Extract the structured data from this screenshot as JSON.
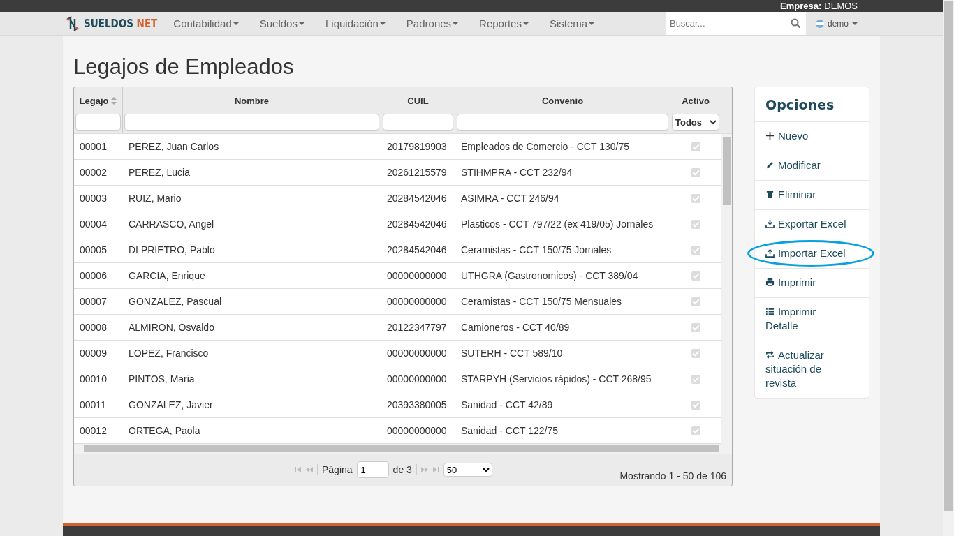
{
  "top_bar": {
    "company_label": "Empresa:",
    "company": "DEMOS"
  },
  "navbar": {
    "brand_a": "SUELDOS",
    "brand_b": "NET",
    "menus": [
      "Contabilidad",
      "Sueldos",
      "Liquidación",
      "Padrones",
      "Reportes",
      "Sistema"
    ],
    "search": {
      "placeholder": "Buscar..."
    },
    "user": "demo"
  },
  "page_title": "Legajos de Empleados",
  "table": {
    "columns": [
      {
        "label": "Legajo",
        "sortable": true,
        "filter": {
          "kind": "text"
        }
      },
      {
        "label": "Nombre",
        "sortable": false,
        "filter": {
          "kind": "text"
        }
      },
      {
        "label": "CUIL",
        "sortable": false,
        "filter": {
          "kind": "text"
        }
      },
      {
        "label": "Convenio",
        "sortable": false,
        "filter": {
          "kind": "text"
        }
      },
      {
        "label": "Activo",
        "sortable": false,
        "filter": {
          "kind": "select",
          "value": "Todos"
        }
      }
    ],
    "rows": [
      {
        "legajo": "00001",
        "nombre": "PEREZ, Juan Carlos",
        "cuil": "20179819903",
        "convenio": "Empleados de Comercio - CCT 130/75",
        "active": true
      },
      {
        "legajo": "00002",
        "nombre": "PEREZ, Lucia",
        "cuil": "20261215579",
        "convenio": "STIHMPRA - CCT 232/94",
        "active": true
      },
      {
        "legajo": "00003",
        "nombre": "RUIZ, Mario",
        "cuil": "20284542046",
        "convenio": "ASIMRA - CCT 246/94",
        "active": true
      },
      {
        "legajo": "00004",
        "nombre": "CARRASCO, Angel",
        "cuil": "20284542046",
        "convenio": "Plasticos - CCT 797/22 (ex 419/05) Jornales",
        "active": true
      },
      {
        "legajo": "00005",
        "nombre": "DI PRIETRO, Pablo",
        "cuil": "20284542046",
        "convenio": "Ceramistas - CCT 150/75 Jornales",
        "active": true
      },
      {
        "legajo": "00006",
        "nombre": "GARCIA, Enrique",
        "cuil": "00000000000",
        "convenio": "UTHGRA (Gastronomicos) - CCT 389/04",
        "active": true
      },
      {
        "legajo": "00007",
        "nombre": "GONZALEZ, Pascual",
        "cuil": "00000000000",
        "convenio": "Ceramistas - CCT 150/75 Mensuales",
        "active": true
      },
      {
        "legajo": "00008",
        "nombre": "ALMIRON, Osvaldo",
        "cuil": "20122347797",
        "convenio": "Camioneros - CCT 40/89",
        "active": true
      },
      {
        "legajo": "00009",
        "nombre": "LOPEZ, Francisco",
        "cuil": "00000000000",
        "convenio": "SUTERH - CCT 589/10",
        "active": true
      },
      {
        "legajo": "00010",
        "nombre": "PINTOS, Maria",
        "cuil": "00000000000",
        "convenio": "STARPYH (Servicios rápidos) - CCT 268/95",
        "active": true
      },
      {
        "legajo": "00011",
        "nombre": "GONZALEZ, Javier",
        "cuil": "20393380005",
        "convenio": "Sanidad - CCT 42/89",
        "active": true
      },
      {
        "legajo": "00012",
        "nombre": "ORTEGA, Paola",
        "cuil": "00000000000",
        "convenio": "Sanidad - CCT 122/75",
        "active": true
      }
    ],
    "pager": {
      "page_label": "Página",
      "page": "1",
      "of_label": "de 3",
      "page_size": "50",
      "summary": "Mostrando 1 - 50 de 106"
    }
  },
  "options": {
    "title": "Opciones",
    "items": [
      {
        "kind": "plus",
        "label": "Nuevo",
        "highlighted": false
      },
      {
        "kind": "pencil",
        "label": "Modificar",
        "highlighted": false
      },
      {
        "kind": "trash",
        "label": "Eliminar",
        "highlighted": false
      },
      {
        "kind": "download",
        "label": "Exportar Excel",
        "highlighted": false
      },
      {
        "kind": "upload",
        "label": "Importar Excel",
        "highlighted": true
      },
      {
        "kind": "print",
        "label": "Imprimir",
        "highlighted": false
      },
      {
        "kind": "list",
        "label": "Imprimir Detalle",
        "highlighted": false
      },
      {
        "kind": "refresh",
        "label": "Actualizar situación de revista",
        "highlighted": false
      }
    ]
  }
}
